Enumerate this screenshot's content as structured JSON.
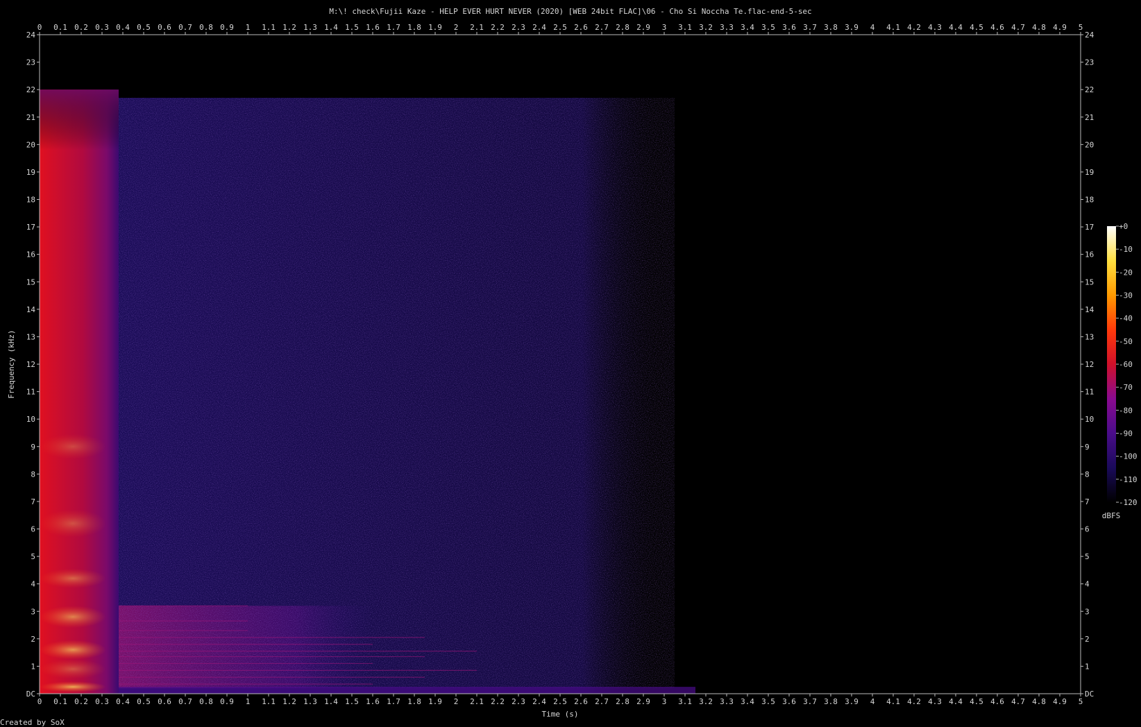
{
  "chart_data": {
    "type": "heatmap",
    "title": "M:\\! check\\Fujii Kaze - HELP EVER HURT NEVER (2020) [WEB 24bit FLAC]\\06 - Cho Si Noccha Te.flac-end-5-sec",
    "xlabel": "Time (s)",
    "ylabel": "Frequency (kHz)",
    "xlim": [
      0,
      5
    ],
    "ylim": [
      0,
      24
    ],
    "x_ticks": [
      "0",
      "0.1",
      "0.2",
      "0.3",
      "0.4",
      "0.5",
      "0.6",
      "0.7",
      "0.8",
      "0.9",
      "1",
      "1.1",
      "1.2",
      "1.3",
      "1.4",
      "1.5",
      "1.6",
      "1.7",
      "1.8",
      "1.9",
      "2",
      "2.1",
      "2.2",
      "2.3",
      "2.4",
      "2.5",
      "2.6",
      "2.7",
      "2.8",
      "2.9",
      "3",
      "3.1",
      "3.2",
      "3.3",
      "3.4",
      "3.5",
      "3.6",
      "3.7",
      "3.8",
      "3.9",
      "4",
      "4.1",
      "4.2",
      "4.3",
      "4.4",
      "4.5",
      "4.6",
      "4.7",
      "4.8",
      "4.9",
      "5"
    ],
    "y_ticks": [
      "DC",
      "1",
      "2",
      "3",
      "4",
      "5",
      "6",
      "7",
      "8",
      "9",
      "10",
      "11",
      "12",
      "13",
      "14",
      "15",
      "16",
      "17",
      "18",
      "19",
      "20",
      "21",
      "22",
      "23",
      "24"
    ],
    "colorbar": {
      "label": "dBFS",
      "ticks": [
        "+0",
        "-10",
        "-20",
        "-30",
        "-40",
        "-50",
        "-60",
        "-70",
        "-80",
        "-90",
        "-100",
        "-110",
        "-120"
      ],
      "range": [
        -120,
        0
      ],
      "colors": [
        "#000000",
        "#1a0a5a",
        "#4a0c8a",
        "#8a0a90",
        "#d0102a",
        "#ff3a0a",
        "#ff9a00",
        "#ffe040",
        "#ffffff"
      ]
    },
    "regions": [
      {
        "t": [
          0.0,
          0.38
        ],
        "f": [
          0,
          22
        ],
        "level_db": -65
      },
      {
        "t": [
          0.38,
          3.0
        ],
        "f": [
          0,
          21.7
        ],
        "level_db": -105
      },
      {
        "t": [
          0.38,
          1.6
        ],
        "f": [
          0.2,
          3.2
        ],
        "level_db": -88
      }
    ],
    "footer": "Created by SoX"
  }
}
